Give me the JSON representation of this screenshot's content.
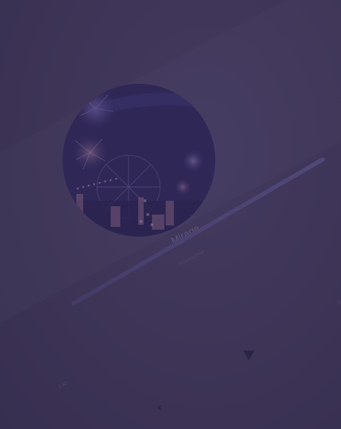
{
  "player": {
    "track_title": "Mirage",
    "artist": "Nocturnal Drive",
    "elapsed": "1:42",
    "progress": 0.0
  },
  "icons": {
    "play": "play-icon",
    "back": "chevron-left-icon",
    "edge": "chevron-right-icon"
  },
  "colors": {
    "background": "#3d3456",
    "album_base": "#2f2857",
    "track": "#423a64",
    "fill": "#504878",
    "text": "#5e567c"
  }
}
